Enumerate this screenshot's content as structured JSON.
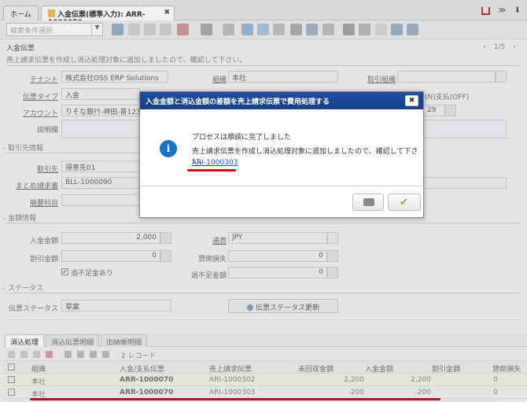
{
  "tabs": {
    "home": "ホーム",
    "active": "入金伝票(標準入力): ARR-1000070",
    "close_glyph": "✖"
  },
  "tabbar_right": {
    "home_icon": "house-icon",
    "menu_glyph": "≫",
    "user_glyph": "⬇"
  },
  "toolbar": {
    "search_placeholder": "検索条件選択",
    "dropdown_glyph": "▼"
  },
  "page": {
    "title": "入金伝票",
    "nav_counter": "1/5",
    "message": "売上請求伝票を作成し消込処理対象に追加しましたので、確認して下さい。",
    "tenant_label": "テナント",
    "tenant_value": "株式会社OSS ERP Solutions",
    "org_label": "組織",
    "org_value": "本社",
    "trx_org_label": "取引組織",
    "doctype_label": "伝票タイプ",
    "doctype_value": "入金",
    "account_label": "アカウント",
    "account_value": "りそな銀行-神田-普12345",
    "date_value": "29",
    "onoff_text": "(N)支払(OFF)",
    "desc_label": "説明欄",
    "partner_section": "取引先情報",
    "partner_label": "取引先",
    "partner_value": "得意先01",
    "invoice_group_label": "まとめ請求書",
    "invoice_group_value": "BLL-1000090",
    "summary_label": "摘要科目",
    "amount_section": "金額情報",
    "payamt_label": "入金金額",
    "payamt_value": "2,000",
    "currency_label": "通貨",
    "currency_value": "JPY",
    "discount_label": "割引金額",
    "discount_value": "0",
    "writeoff_label": "貸倒損失",
    "writeoff_value": "0",
    "overunder_label": "過不足金あり",
    "overunder_checked": "✓",
    "shortage_label": "過不足金額",
    "shortage_value": "0",
    "status_section": "ステータス",
    "docstatus_label": "伝票ステータス",
    "docstatus_value": "草案",
    "status_button": "伝票ステータス更新"
  },
  "bottom": {
    "tabs": [
      "消込処理",
      "消込伝票明細",
      "出納帳明細"
    ],
    "record_count": "2 レコード",
    "columns": [
      "組織",
      "入金/支払伝票",
      "売上請求伝票",
      "未回収金額",
      "入金金額",
      "割引金額",
      "貸倒損失"
    ],
    "rows": [
      [
        "本社",
        "ARR-1000070",
        "ARI-1000302",
        "2,200",
        "2,200",
        "0",
        ""
      ],
      [
        "本社",
        "ARR-1000070",
        "ARI-1000303",
        "-200",
        "-200",
        "0",
        ""
      ]
    ]
  },
  "dialog": {
    "title": "入金金額と消込金額の差額を売上請求伝票で費用処理する",
    "close_glyph": "✖",
    "info_glyph": "i",
    "line1": "プロセスは順調に完了しました",
    "line2": "売上請求伝票を作成し消込処理対象に追加しましたので、確認して下さい。",
    "link": "ARI-1000303",
    "ok_glyph": "✔"
  },
  "colors": {
    "dialog_header": "#1d4fa0",
    "highlight": "#d50e1e",
    "link": "#1a4fcf"
  }
}
